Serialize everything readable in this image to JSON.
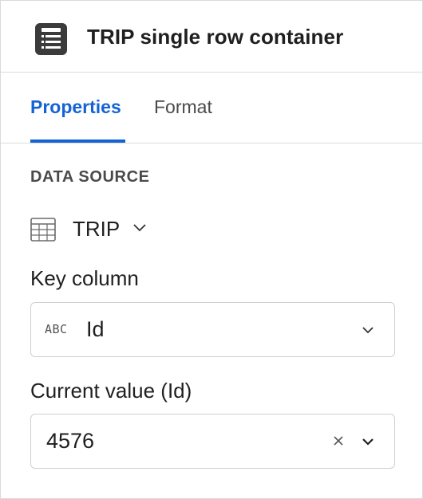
{
  "header": {
    "title": "TRIP single row container",
    "icon": "list-container-icon"
  },
  "tabs": [
    {
      "label": "Properties",
      "active": true
    },
    {
      "label": "Format",
      "active": false
    }
  ],
  "data_source": {
    "section_label": "DATA SOURCE",
    "table_name": "TRIP",
    "icon": "table-icon"
  },
  "key_column": {
    "label": "Key column",
    "type_tag": "ABC",
    "value": "Id"
  },
  "current_value": {
    "label": "Current value (Id)",
    "value": "4576"
  },
  "colors": {
    "accent": "#1463d6",
    "text": "#1f1f1f",
    "muted": "#4a4a4a",
    "border": "#cfcfcf"
  }
}
